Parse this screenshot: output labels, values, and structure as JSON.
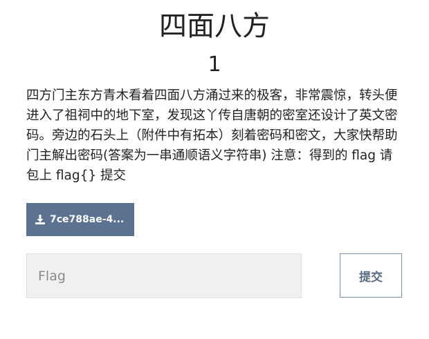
{
  "challenge": {
    "title": "四面八方",
    "points": "1",
    "description": "四方门主东方青木看着四面八方涌过来的极客，非常震惊，转头便进入了祖祠中的地下室，发现这丫传自唐朝的密室还设计了英文密码。旁边的石头上（附件中有拓本）刻着密码和密文，大家快帮助门主解出密码(答案为一串通顺语义字符串) 注意：得到的 flag 请包上 flag{} 提交",
    "attachment_label": "7ce788ae-4...",
    "attachment_icon": "download-icon",
    "flag_placeholder": "Flag",
    "flag_value": "",
    "submit_label": "提交"
  },
  "colors": {
    "attachment_bg": "#5b7290",
    "input_bg": "#f0f0f0",
    "submit_text": "#5a6b82"
  }
}
